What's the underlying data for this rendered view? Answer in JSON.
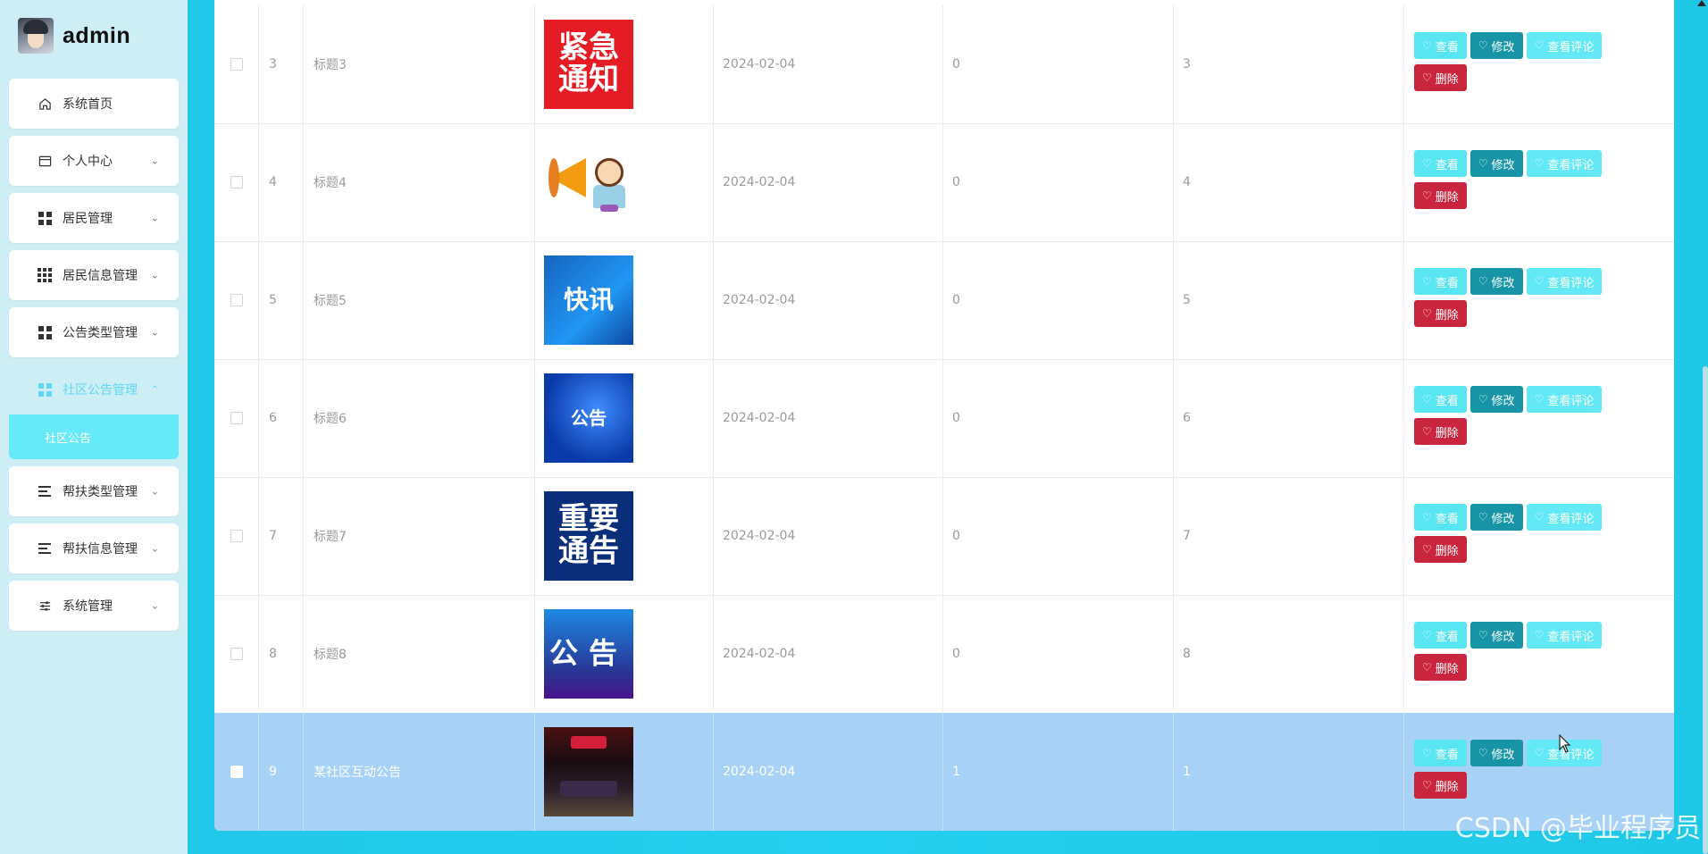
{
  "app": {
    "user_name": "admin"
  },
  "sidebar": {
    "items": [
      {
        "label": "系统首页",
        "icon": "home-icon",
        "expandable": false
      },
      {
        "label": "个人中心",
        "icon": "profile-card-icon",
        "expandable": true
      },
      {
        "label": "居民管理",
        "icon": "grid-icon",
        "expandable": true
      },
      {
        "label": "居民信息管理",
        "icon": "grid9-icon",
        "expandable": true
      },
      {
        "label": "公告类型管理",
        "icon": "grid-icon",
        "expandable": true
      },
      {
        "label": "社区公告管理",
        "icon": "grid-icon",
        "expandable": true,
        "active": true
      },
      {
        "label": "帮扶类型管理",
        "icon": "list-icon",
        "expandable": true
      },
      {
        "label": "帮扶信息管理",
        "icon": "list-icon",
        "expandable": true
      },
      {
        "label": "系统管理",
        "icon": "sliders-icon",
        "expandable": true
      }
    ],
    "submenu_active": "社区公告"
  },
  "table": {
    "rows": [
      {
        "index": "3",
        "title": "标题3",
        "image": "紧急通知",
        "date": "2024-02-04",
        "col_a": "0",
        "col_b": "3"
      },
      {
        "index": "4",
        "title": "标题4",
        "image": "megaphone-girl",
        "date": "2024-02-04",
        "col_a": "0",
        "col_b": "4"
      },
      {
        "index": "5",
        "title": "标题5",
        "image": "快讯",
        "date": "2024-02-04",
        "col_a": "0",
        "col_b": "5"
      },
      {
        "index": "6",
        "title": "标题6",
        "image": "公告",
        "date": "2024-02-04",
        "col_a": "0",
        "col_b": "6"
      },
      {
        "index": "7",
        "title": "标题7",
        "image": "重要通告",
        "date": "2024-02-04",
        "col_a": "0",
        "col_b": "7"
      },
      {
        "index": "8",
        "title": "标题8",
        "image": "公 告",
        "date": "2024-02-04",
        "col_a": "0",
        "col_b": "8"
      },
      {
        "index": "9",
        "title": "某社区互动公告",
        "image": "room-photo",
        "date": "2024-02-04",
        "col_a": "1",
        "col_b": "1",
        "selected": true
      }
    ],
    "thumb_text": {
      "urgent_1": "紧急",
      "urgent_2": "通知",
      "flash": "快讯",
      "notice": "公告",
      "important_1": "重要",
      "important_2": "通告",
      "gonggao": "公告"
    },
    "actions": {
      "view": "查看",
      "edit": "修改",
      "comments": "查看评论",
      "delete": "删除"
    }
  },
  "watermark": "CSDN @毕业程序员",
  "colors": {
    "sidebar_bg": "#cdeef4",
    "accent": "#5fd8f0",
    "view_btn": "#59e6f3",
    "edit_btn": "#1795a6",
    "delete_btn": "#c9263e",
    "selected_row": "#a7d1f5"
  }
}
